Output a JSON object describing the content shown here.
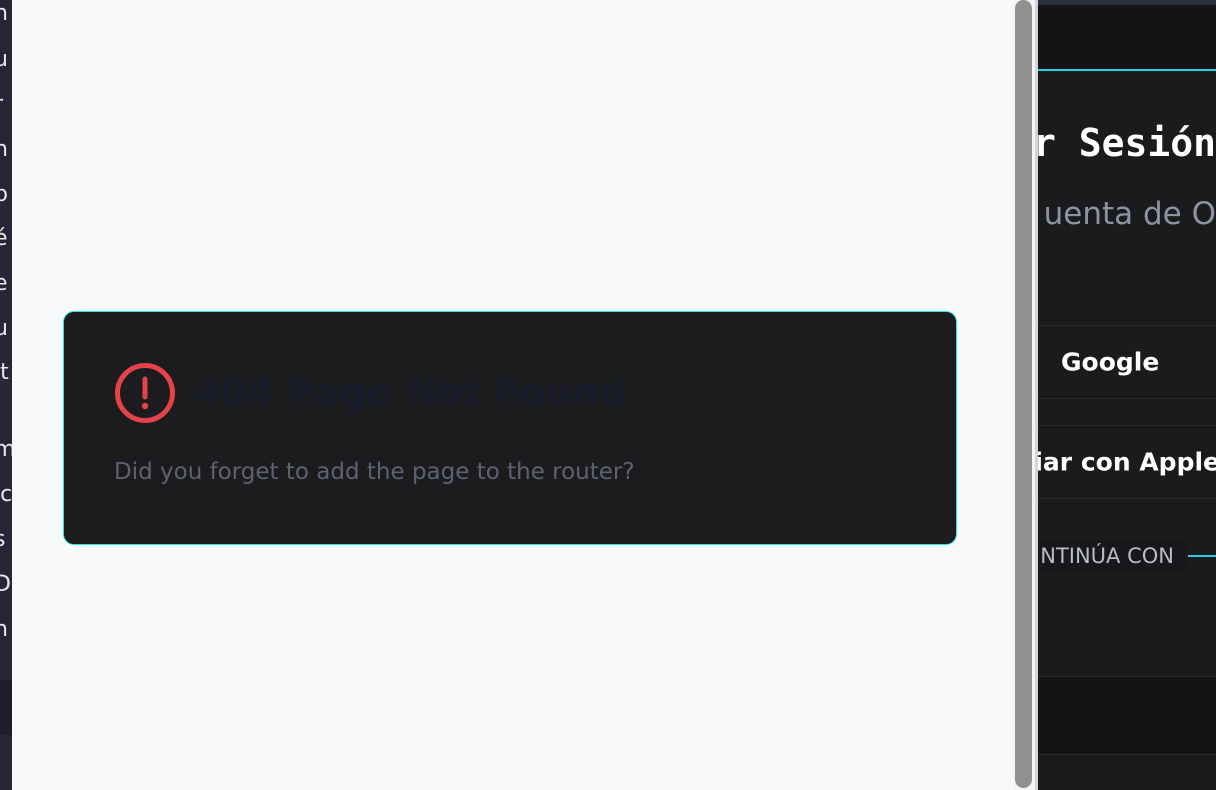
{
  "background_left": {
    "fragments": [
      "h",
      "u",
      "r",
      "n",
      "p",
      "é",
      "e",
      "u",
      "lt",
      "m",
      "ic",
      "s",
      "D",
      "n"
    ]
  },
  "error": {
    "icon": "alert-circle-icon",
    "title": "404 Page Not Found",
    "message": "Did you forget to add the page to the router?"
  },
  "background_right": {
    "login_title": "ar Sesión",
    "login_subtitle": "uenta de O",
    "google_label": "Google",
    "apple_label": "ciar con Apple",
    "divider_text": "NTINÚA CON"
  },
  "colors": {
    "card_background": "#1c1c1e",
    "card_border": "#27e6e6",
    "alert_icon": "#e5424a",
    "title_text": "#191c2a",
    "message_text": "#5d6273",
    "page_background": "#f8f9fb",
    "accent": "#25d3e0"
  }
}
